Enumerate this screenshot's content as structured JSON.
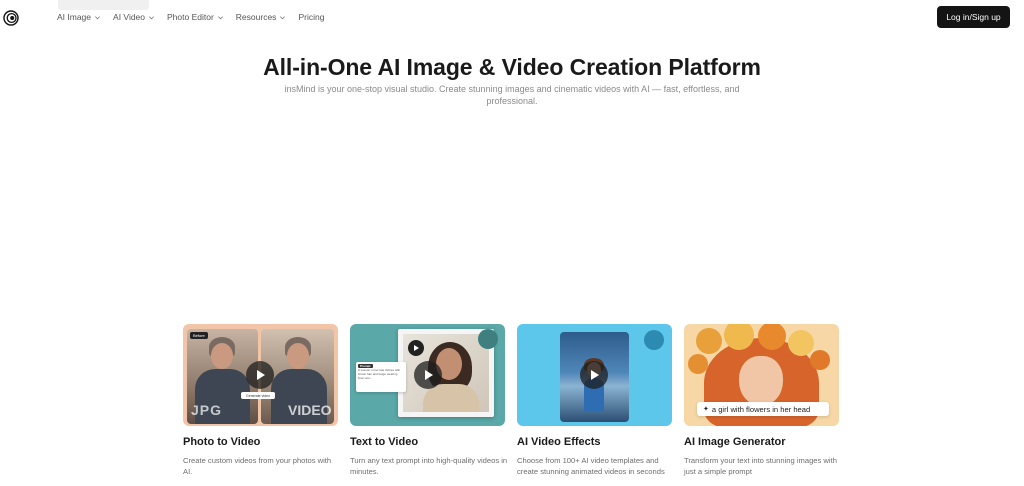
{
  "nav": {
    "items": [
      {
        "label": "AI Image",
        "has_dropdown": true
      },
      {
        "label": "AI Video",
        "has_dropdown": true
      },
      {
        "label": "Photo Editor",
        "has_dropdown": true
      },
      {
        "label": "Resources",
        "has_dropdown": true
      },
      {
        "label": "Pricing",
        "has_dropdown": false
      }
    ],
    "login_label": "Log in/Sign up",
    "logo_icon": "spiral-logo-icon"
  },
  "hero": {
    "title": "All-in-One AI Image & Video Creation Platform",
    "subtitle": "insMind is your one-stop visual studio. Create stunning images and cinematic videos with AI — fast, effortless, and professional."
  },
  "cards": [
    {
      "title": "Photo to Video",
      "description": "Create custom videos from your photos with AI.",
      "thumb": {
        "left_label": "JPG",
        "right_label": "VIDEO",
        "badge": "Before",
        "button": "Generate video"
      }
    },
    {
      "title": "Text to Video",
      "description": "Turn any text prompt into high-quality videos in minutes.",
      "thumb": {
        "prompt_tag": "Prompt",
        "prompt_text": "A woman in her late thirties with brown hair and beige wearing linen wor..."
      }
    },
    {
      "title": "AI Video Effects",
      "description": "Choose from 100+ AI video templates and create stunning animated videos in seconds"
    },
    {
      "title": "AI Image Generator",
      "description": "Transform your text into stunning images with just a simple prompt",
      "thumb": {
        "prompt_text": "a girl with flowers in her head",
        "prompt_icon": "sparkle-icon"
      }
    }
  ],
  "colors": {
    "login_bg": "#141414",
    "card1_bg": "#f3c5a8",
    "card2_bg": "#5aa8a8",
    "card3_bg": "#5cc6eb",
    "card4_bg": "#f6d7a5"
  }
}
